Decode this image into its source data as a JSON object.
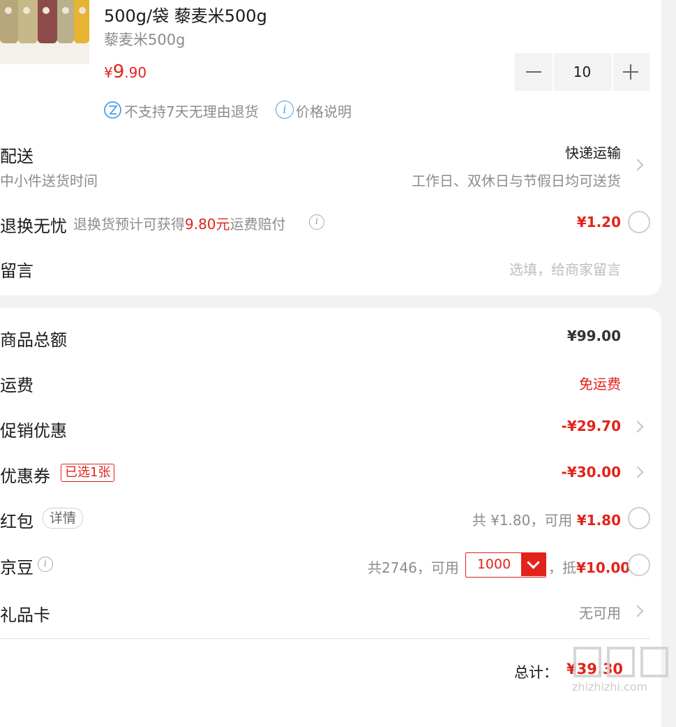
{
  "product": {
    "title": "500g/袋 藜麦米500g",
    "spec": "藜麦米500g",
    "price_symbol": "¥",
    "price_int": "9",
    "price_dec": ".90",
    "quantity": "10",
    "no_return_label": "不支持7天无理由退货",
    "price_note_label": "价格说明"
  },
  "delivery": {
    "label": "配送",
    "sub": "中小件送货时间",
    "method": "快递运输",
    "schedule": "工作日、双休日与节假日均可送货"
  },
  "return_insurance": {
    "label": "退换无忧",
    "desc_pre": "退换货预计可获得",
    "desc_amount": "9.80元",
    "desc_post": "运费赔付",
    "price": "¥1.20"
  },
  "message": {
    "label": "留言",
    "placeholder": "选填，给商家留言"
  },
  "summary": {
    "goods_total_label": "商品总额",
    "goods_total": "¥99.00",
    "shipping_label": "运费",
    "shipping_value": "免运费",
    "promo_label": "促销优惠",
    "promo_value": "-¥29.70",
    "coupon_label": "优惠券",
    "coupon_badge": "已选1张",
    "coupon_value": "-¥30.00",
    "redpacket_label": "红包",
    "redpacket_detail": "详情",
    "redpacket_total": "共 ¥1.80，可用",
    "redpacket_available": "¥1.80",
    "jingdou_label": "京豆",
    "jingdou_total": "共2746，可用",
    "jingdou_select": "1000",
    "jingdou_deduct_pre": "，抵",
    "jingdou_deduct": "¥10.00",
    "giftcard_label": "礼品卡",
    "giftcard_value": "无可用",
    "total_label": "总计：",
    "total_value": "¥39.30"
  },
  "watermark": {
    "text": "值值值",
    "url": "zhizhizhi.com"
  },
  "colors": {
    "accent": "#e2231a",
    "background": "#f2f2f2",
    "info_icon": "#4a9fe8"
  },
  "icons": {
    "no_return": "no-return-icon",
    "price_info": "info-icon",
    "chevron": "chevron-right-icon",
    "radio": "radio-unchecked",
    "stepper_minus": "minus-icon",
    "stepper_plus": "plus-icon",
    "dropdown": "chevron-down-icon"
  }
}
